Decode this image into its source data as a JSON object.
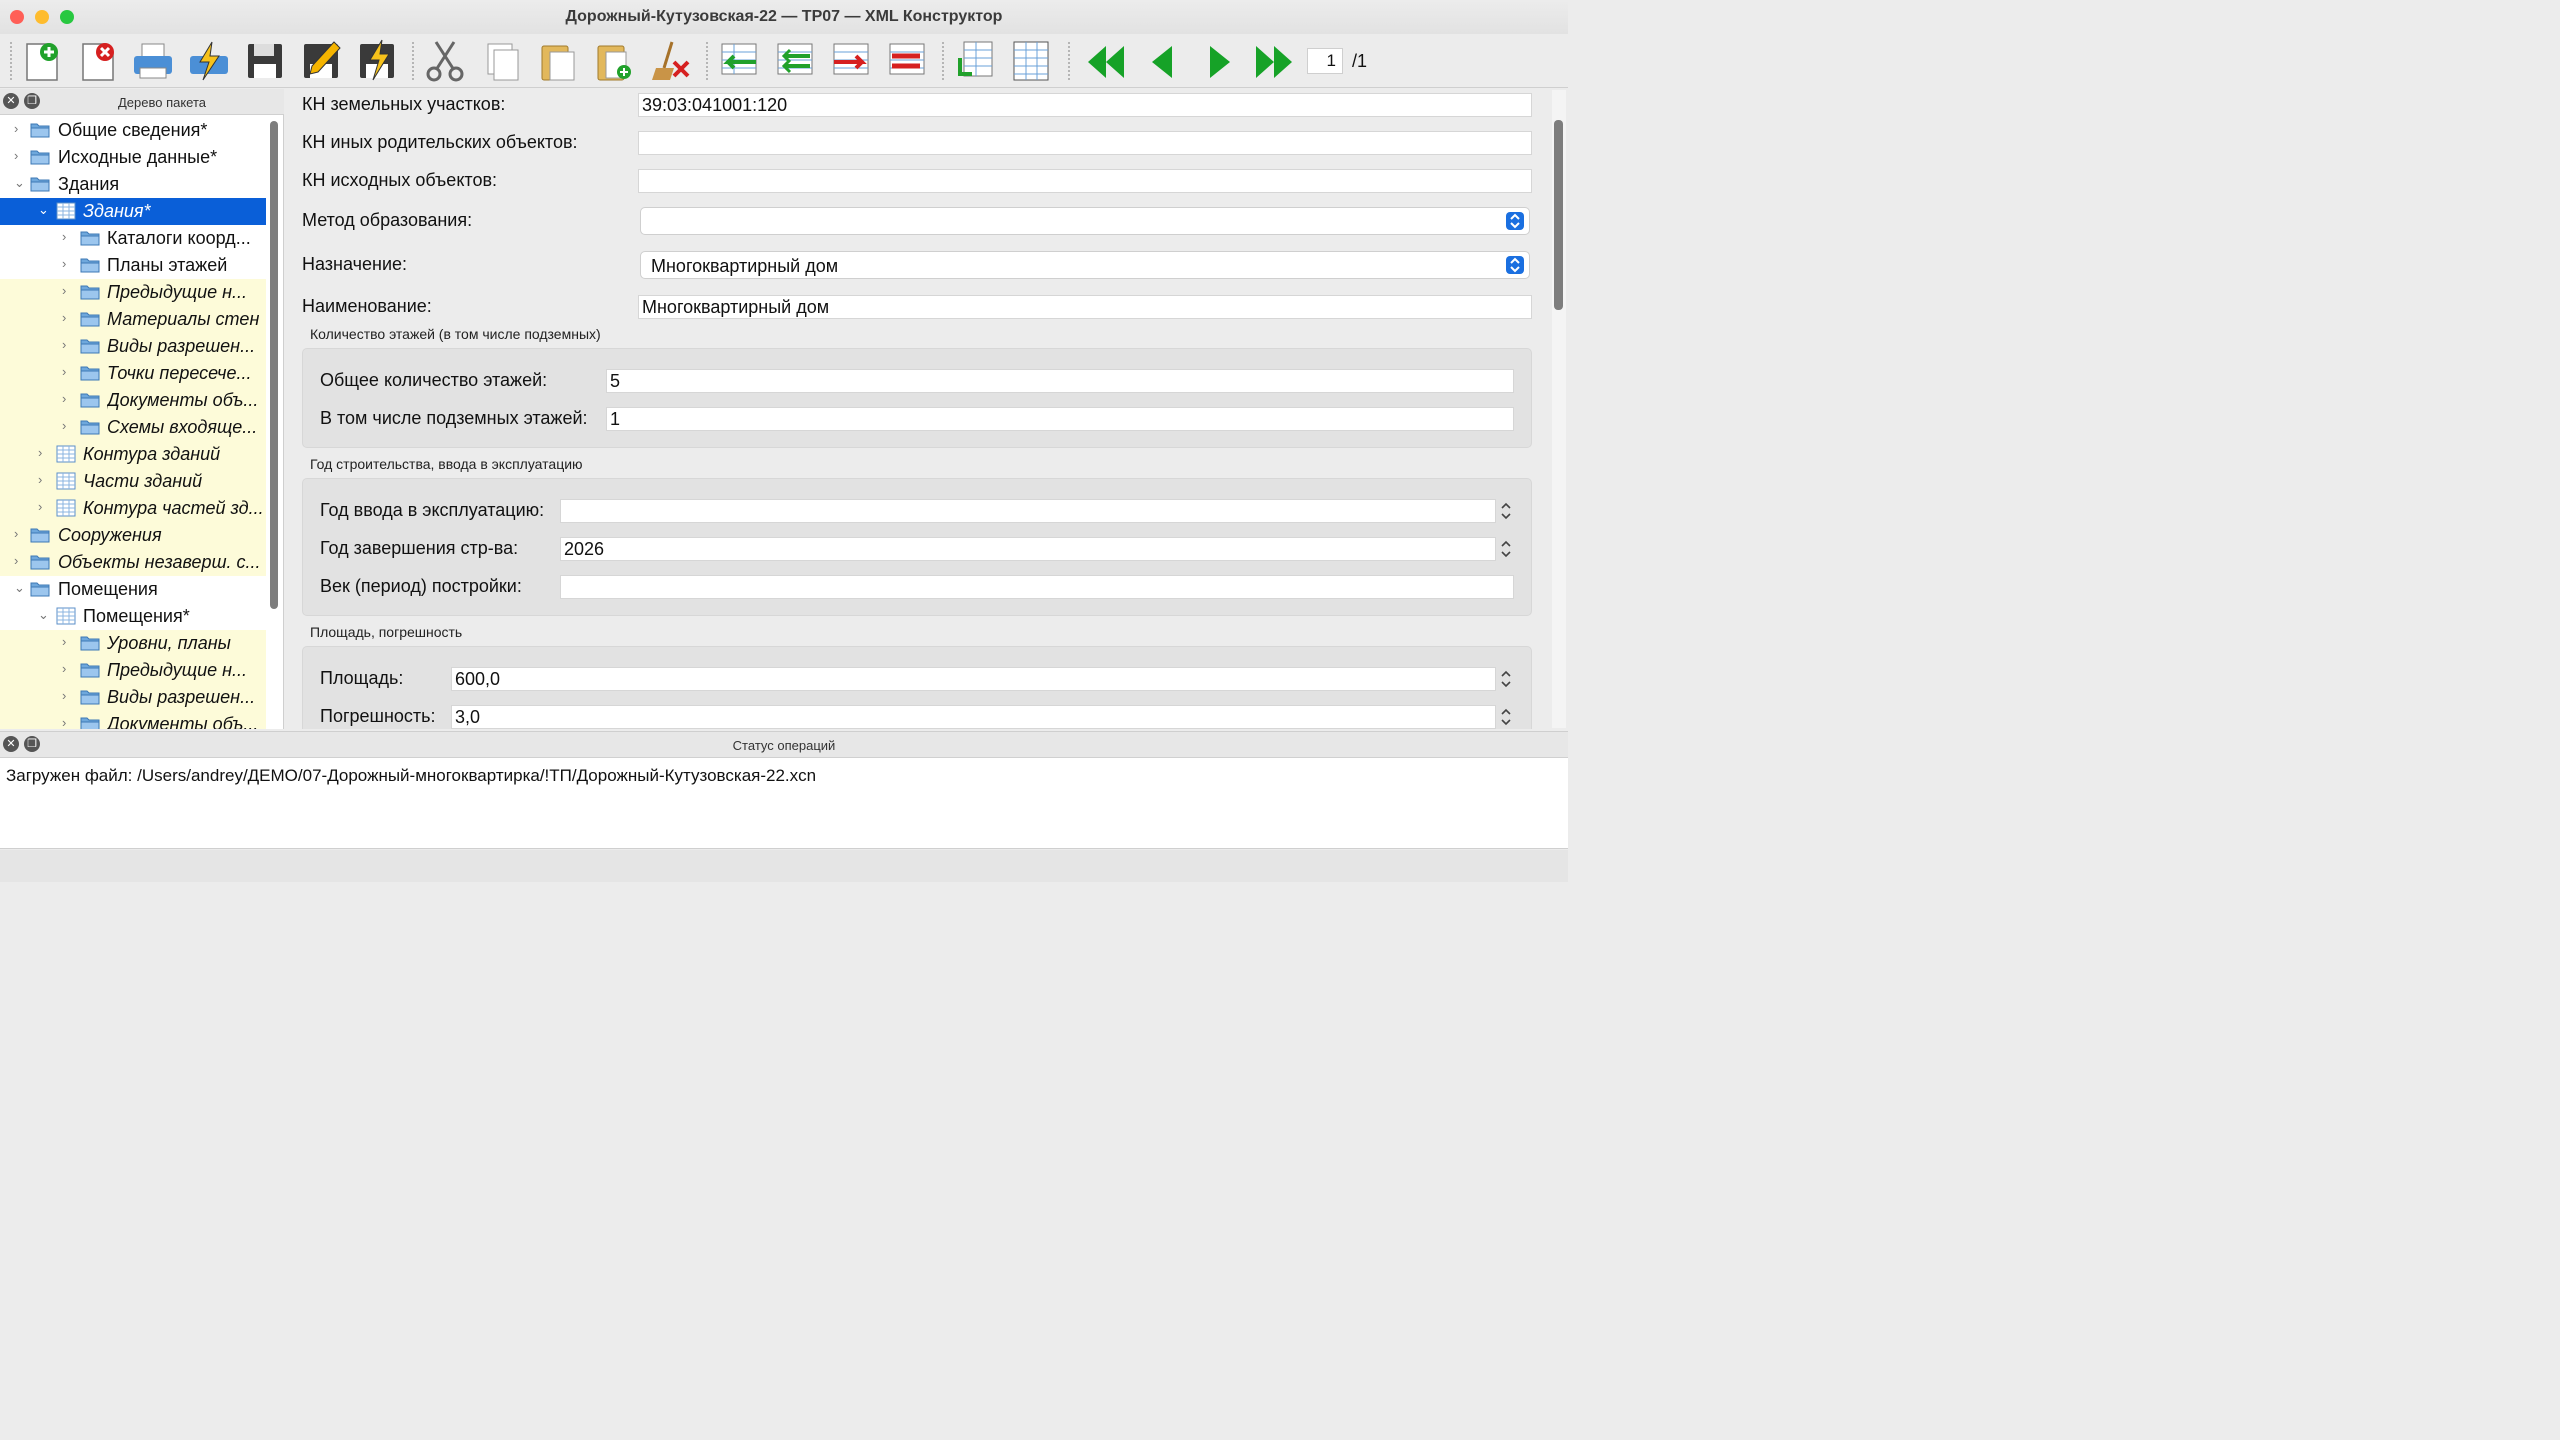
{
  "window": {
    "title": "Дорожный-Кутузовская-22 — ТР07 — XML Конструктор"
  },
  "toolbar": {
    "buttons": [
      "new-doc",
      "delete-doc",
      "print",
      "validate",
      "save",
      "edit",
      "sign",
      "cut",
      "copy",
      "paste",
      "paste-new",
      "clear",
      "row-insert-left",
      "row-move",
      "row-send",
      "row-delete",
      "export",
      "table-view",
      "first",
      "prev",
      "next",
      "last"
    ],
    "page_current": "1",
    "page_total": "/1"
  },
  "tree": {
    "title": "Дерево пакета",
    "items": [
      {
        "label": "Общие сведения*"
      },
      {
        "label": "Исходные данные*"
      },
      {
        "label": "Здания"
      },
      {
        "label": "Здания*"
      },
      {
        "label": "Каталоги коорд..."
      },
      {
        "label": "Планы этажей"
      },
      {
        "label": "Предыдущие н..."
      },
      {
        "label": "Материалы стен"
      },
      {
        "label": "Виды разрешен..."
      },
      {
        "label": "Точки пересече..."
      },
      {
        "label": "Документы объ..."
      },
      {
        "label": "Схемы входяще..."
      },
      {
        "label": "Контура зданий"
      },
      {
        "label": "Части зданий"
      },
      {
        "label": "Контура частей зд..."
      },
      {
        "label": "Сооружения"
      },
      {
        "label": "Объекты незаверш. с..."
      },
      {
        "label": "Помещения"
      },
      {
        "label": "Помещения*"
      },
      {
        "label": "Уровни, планы"
      },
      {
        "label": "Предыдущие н..."
      },
      {
        "label": "Виды разрешен..."
      },
      {
        "label": "Документы объ..."
      }
    ]
  },
  "form": {
    "kn_land_label": "КН земельных участков:",
    "kn_land_value": "39:03:041001:120",
    "kn_parent_label": "КН иных родительских объектов:",
    "kn_parent_value": "",
    "kn_source_label": "КН исходных объектов:",
    "kn_source_value": "",
    "method_label": "Метод образования:",
    "method_value": "",
    "purpose_label": "Назначение:",
    "purpose_value": "Многоквартирный дом",
    "name_label": "Наименование:",
    "name_value": "Многоквартирный дом",
    "floors_group": "Количество этажей (в том числе подземных)",
    "floors_total_label": "Общее количество этажей:",
    "floors_total_value": "5",
    "floors_under_label": "В том числе подземных этажей:",
    "floors_under_value": "1",
    "year_group": "Год строительства, ввода в эксплуатацию",
    "year_commission_label": "Год ввода в эксплуатацию:",
    "year_commission_value": "",
    "year_built_label": "Год завершения стр-ва:",
    "year_built_value": "2026",
    "century_label": "Век (период) постройки:",
    "century_value": "",
    "area_group": "Площадь, погрешность",
    "area_label": "Площадь:",
    "area_value": "600,0",
    "error_label": "Погрешность:",
    "error_value": "3,0"
  },
  "status": {
    "title": "Статус операций",
    "message": "Загружен файл: /Users/andrey/ДЕМО/07-Дорожный-многоквартирка/!ТП/Дорожный-Кутузовская-22.xcn"
  }
}
